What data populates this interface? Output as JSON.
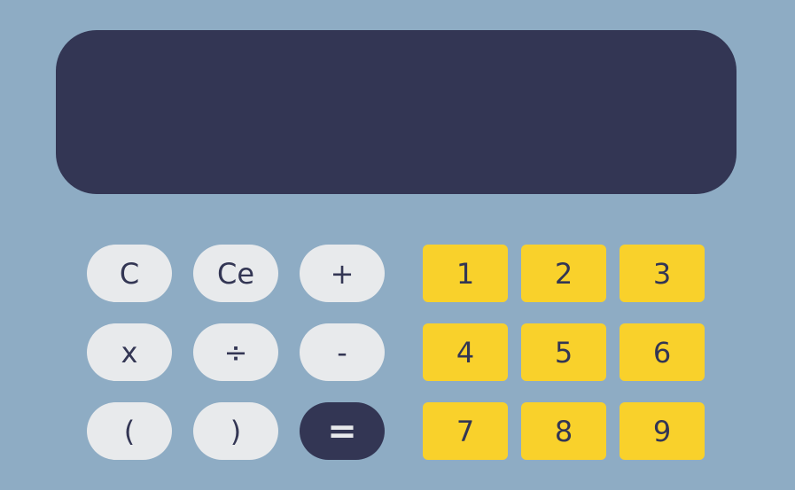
{
  "display": {
    "value": ""
  },
  "operators": [
    {
      "label": "C",
      "name": "clear-button"
    },
    {
      "label": "Ce",
      "name": "clear-entry-button"
    },
    {
      "label": "+",
      "name": "add-button"
    },
    {
      "label": "x",
      "name": "multiply-button"
    },
    {
      "label": "÷",
      "name": "divide-button"
    },
    {
      "label": "-",
      "name": "subtract-button"
    },
    {
      "label": "(",
      "name": "open-paren-button"
    },
    {
      "label": ")",
      "name": "close-paren-button"
    },
    {
      "label": "=",
      "name": "equals-button"
    }
  ],
  "digits": [
    "1",
    "2",
    "3",
    "4",
    "5",
    "6",
    "7",
    "8",
    "9"
  ],
  "colors": {
    "background": "#8eacc4",
    "display": "#333654",
    "operator": "#e8eaec",
    "digit": "#f9d12b",
    "text": "#333654"
  }
}
